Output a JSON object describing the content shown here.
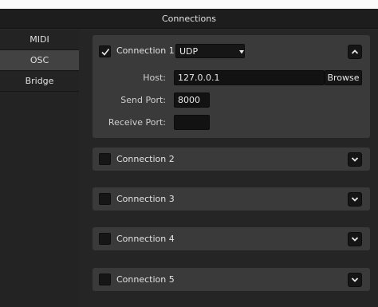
{
  "title": "Connections",
  "sidebar": {
    "items": [
      {
        "label": "MIDI"
      },
      {
        "label": "OSC"
      },
      {
        "label": "Bridge"
      }
    ]
  },
  "connections": [
    {
      "label": "Connection 1",
      "checked": true,
      "expanded": true,
      "protocol": "UDP",
      "host_label": "Host:",
      "host": "127.0.0.1",
      "browse_label": "Browse",
      "send_port_label": "Send Port:",
      "send_port": "8000",
      "receive_port_label": "Receive Port:",
      "receive_port": ""
    },
    {
      "label": "Connection 2",
      "checked": false,
      "expanded": false
    },
    {
      "label": "Connection 3",
      "checked": false,
      "expanded": false
    },
    {
      "label": "Connection 4",
      "checked": false,
      "expanded": false
    },
    {
      "label": "Connection 5",
      "checked": false,
      "expanded": false
    }
  ],
  "icons": {
    "checkmark": "checkmark-icon",
    "dropdown": "caret-down-icon",
    "collapse": "chevron-up-icon",
    "expand": "chevron-down-icon"
  },
  "colors": {
    "window_bg": "#2b2b2b",
    "panel_bg": "#3a3a3a",
    "sidebar_active": "#424242",
    "field_bg": "#121212"
  }
}
